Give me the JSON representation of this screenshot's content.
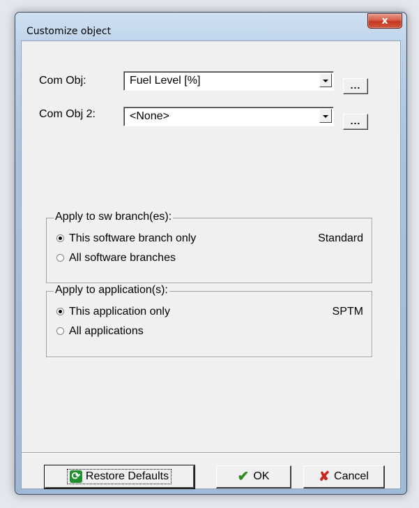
{
  "window": {
    "title": "Customize object",
    "close_glyph": "x"
  },
  "fields": {
    "com_obj": {
      "label": "Com Obj:",
      "value": "Fuel Level [%]",
      "browse": "..."
    },
    "com_obj2": {
      "label": "Com Obj 2:",
      "value": "<None>",
      "browse": "..."
    }
  },
  "sw_branch_group": {
    "title": "Apply to sw branch(es):",
    "options": [
      {
        "label": "This software branch only",
        "checked": true
      },
      {
        "label": "All software branches",
        "checked": false
      }
    ],
    "current": "Standard"
  },
  "application_group": {
    "title": "Apply to application(s):",
    "options": [
      {
        "label": "This application only",
        "checked": true
      },
      {
        "label": "All applications",
        "checked": false
      }
    ],
    "current": "SPTM"
  },
  "buttons": {
    "restore": {
      "label": "Restore Defaults",
      "icon": "refresh-icon"
    },
    "ok": {
      "label": "OK",
      "icon": "checkmark-icon"
    },
    "cancel": {
      "label": "Cancel",
      "icon": "x-icon"
    }
  },
  "colors": {
    "check_green": "#2e8b1e",
    "cancel_red": "#c8281c",
    "close_red": "#c23a22"
  }
}
